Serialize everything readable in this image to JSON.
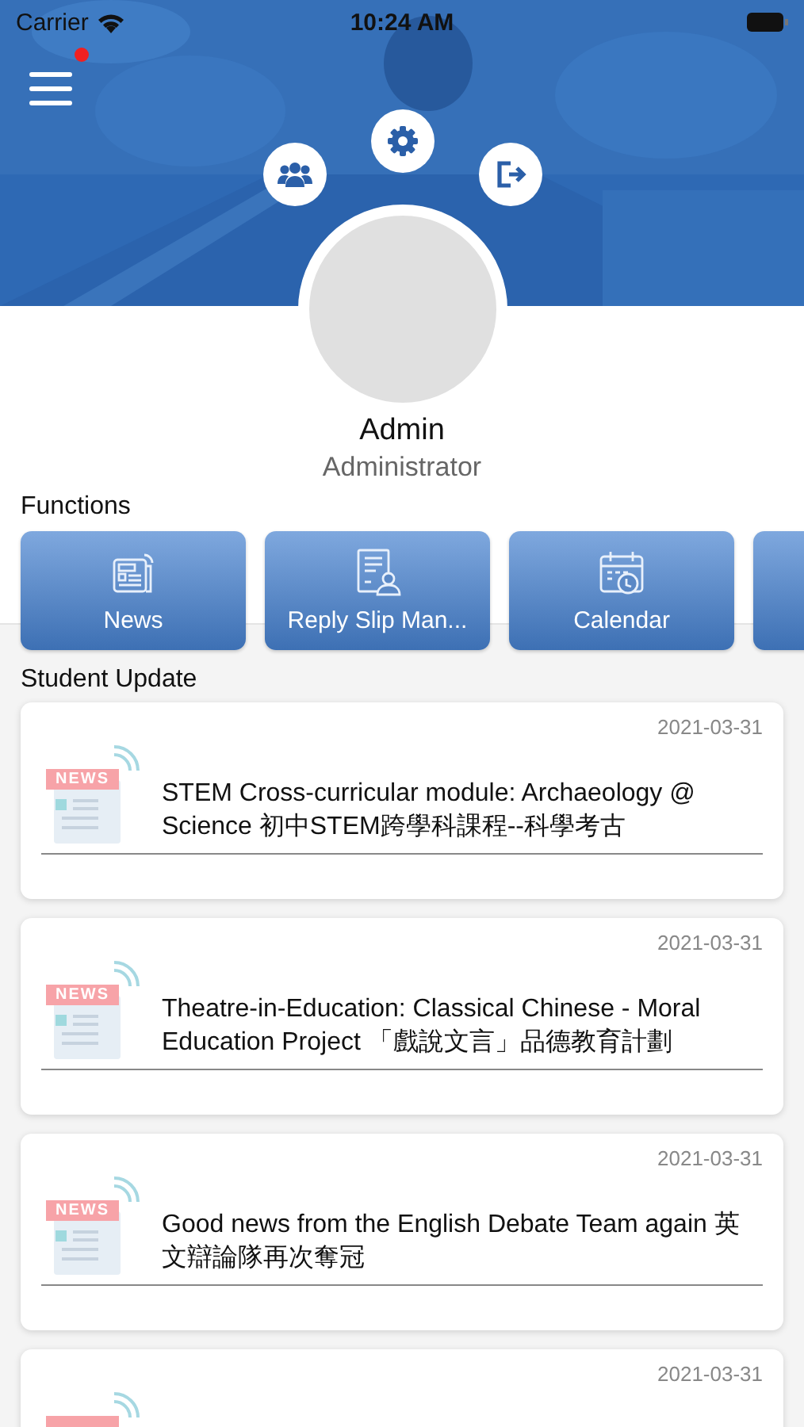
{
  "status_bar": {
    "carrier": "Carrier",
    "time": "10:24 AM"
  },
  "menu": {
    "has_notification": true
  },
  "profile": {
    "name": "Admin",
    "role": "Administrator"
  },
  "functions": {
    "title": "Functions",
    "items": [
      {
        "label": "News",
        "kind": "news"
      },
      {
        "label": "Reply Slip Man...",
        "kind": "reply"
      },
      {
        "label": "Calendar",
        "kind": "calendar"
      }
    ]
  },
  "updates": {
    "title": "Student Update",
    "items": [
      {
        "date": "2021-03-31",
        "badge": "NEWS",
        "title": "STEM Cross-curricular module: Archaeology @ Science  初中STEM跨學科課程--科學考古"
      },
      {
        "date": "2021-03-31",
        "badge": "NEWS",
        "title": "Theatre-in-Education: Classical Chinese - Moral Education Project 「戲說文言」品德教育計劃"
      },
      {
        "date": "2021-03-31",
        "badge": "NEWS",
        "title": "Good news from the English Debate Team again  英文辯論隊再次奪冠"
      },
      {
        "date": "2021-03-31"
      }
    ]
  }
}
